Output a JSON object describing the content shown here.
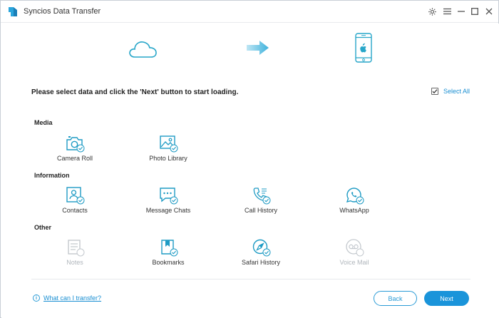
{
  "window": {
    "title": "Syncios Data Transfer"
  },
  "titlebar": {
    "icons": [
      "settings-icon",
      "menu-icon",
      "minimize-icon",
      "maximize-icon",
      "close-icon"
    ]
  },
  "hero": {
    "icons": [
      "cloud-icon",
      "arrow-right-icon",
      "iphone-icon"
    ]
  },
  "main": {
    "instruction": "Please select data and click the 'Next' button to start loading.",
    "select_all": {
      "label": "Select All",
      "checked": true
    }
  },
  "sections": [
    {
      "label": "Media",
      "items": [
        {
          "label": "Camera Roll",
          "icon": "camera-icon",
          "checked": true,
          "enabled": true
        },
        {
          "label": "Photo Library",
          "icon": "photo-icon",
          "checked": true,
          "enabled": true
        }
      ]
    },
    {
      "label": "Information",
      "items": [
        {
          "label": "Contacts",
          "icon": "contacts-icon",
          "checked": true,
          "enabled": true
        },
        {
          "label": "Message Chats",
          "icon": "message-icon",
          "checked": true,
          "enabled": true
        },
        {
          "label": "Call History",
          "icon": "phone-icon",
          "checked": true,
          "enabled": true
        },
        {
          "label": "WhatsApp",
          "icon": "whatsapp-icon",
          "checked": true,
          "enabled": true
        }
      ]
    },
    {
      "label": "Other",
      "items": [
        {
          "label": "Notes",
          "icon": "notes-icon",
          "checked": false,
          "enabled": false
        },
        {
          "label": "Bookmarks",
          "icon": "bookmark-icon",
          "checked": true,
          "enabled": true
        },
        {
          "label": "Safari History",
          "icon": "compass-icon",
          "checked": true,
          "enabled": true
        },
        {
          "label": "Voice Mail",
          "icon": "voicemail-icon",
          "checked": false,
          "enabled": false
        }
      ]
    }
  ],
  "footer": {
    "help_label": "What can I transfer?",
    "back_label": "Back",
    "next_label": "Next"
  },
  "colors": {
    "accent": "#1a94da",
    "icon": "#1e9bc4",
    "disabled": "#c4c9ce"
  }
}
